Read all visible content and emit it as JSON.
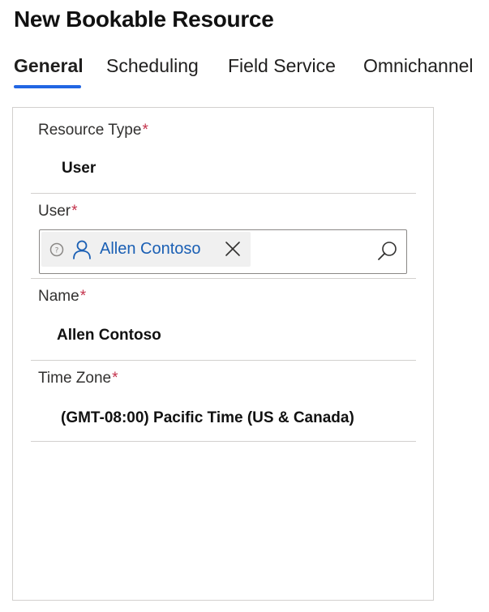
{
  "page": {
    "title": "New Bookable Resource"
  },
  "tabs": [
    {
      "label": "General",
      "active": true
    },
    {
      "label": "Scheduling",
      "active": false
    },
    {
      "label": "Field Service",
      "active": false
    },
    {
      "label": "Omnichannel",
      "active": false
    }
  ],
  "form": {
    "required_marker": "*",
    "resource_type": {
      "label": "Resource Type",
      "value": "User"
    },
    "user": {
      "label": "User",
      "selected_name": "Allen Contoso",
      "icons": {
        "status": "presence-unknown-icon",
        "entity": "person-icon",
        "remove": "close-icon",
        "search": "search-icon"
      }
    },
    "name": {
      "label": "Name",
      "value": "Allen Contoso"
    },
    "time_zone": {
      "label": "Time Zone",
      "value": "(GMT-08:00) Pacific Time (US & Canada)"
    }
  },
  "colors": {
    "accent": "#2266e3",
    "required": "#c4314b",
    "link": "#1a5fb4",
    "border": "#d2d0ce"
  }
}
